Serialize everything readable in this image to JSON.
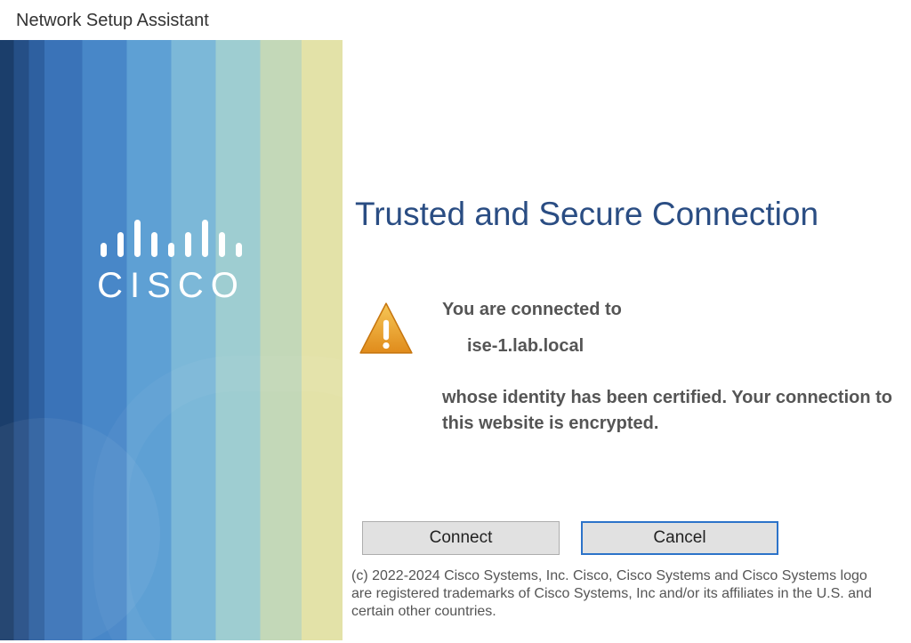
{
  "window": {
    "title": "Network Setup Assistant"
  },
  "brand": {
    "logo_text": "CISCO"
  },
  "content": {
    "headline": "Trusted and Secure Connection",
    "connected_label": "You are connected to",
    "host": "ise-1.lab.local",
    "identity_text": "whose identity has been certified. Your connection to this website is encrypted."
  },
  "buttons": {
    "connect": "Connect",
    "cancel": "Cancel"
  },
  "legal": "(c) 2022-2024 Cisco Systems, Inc. Cisco, Cisco Systems and Cisco Systems logo are registered trademarks of Cisco Systems, Inc and/or its affiliates in the U.S. and certain other countries."
}
